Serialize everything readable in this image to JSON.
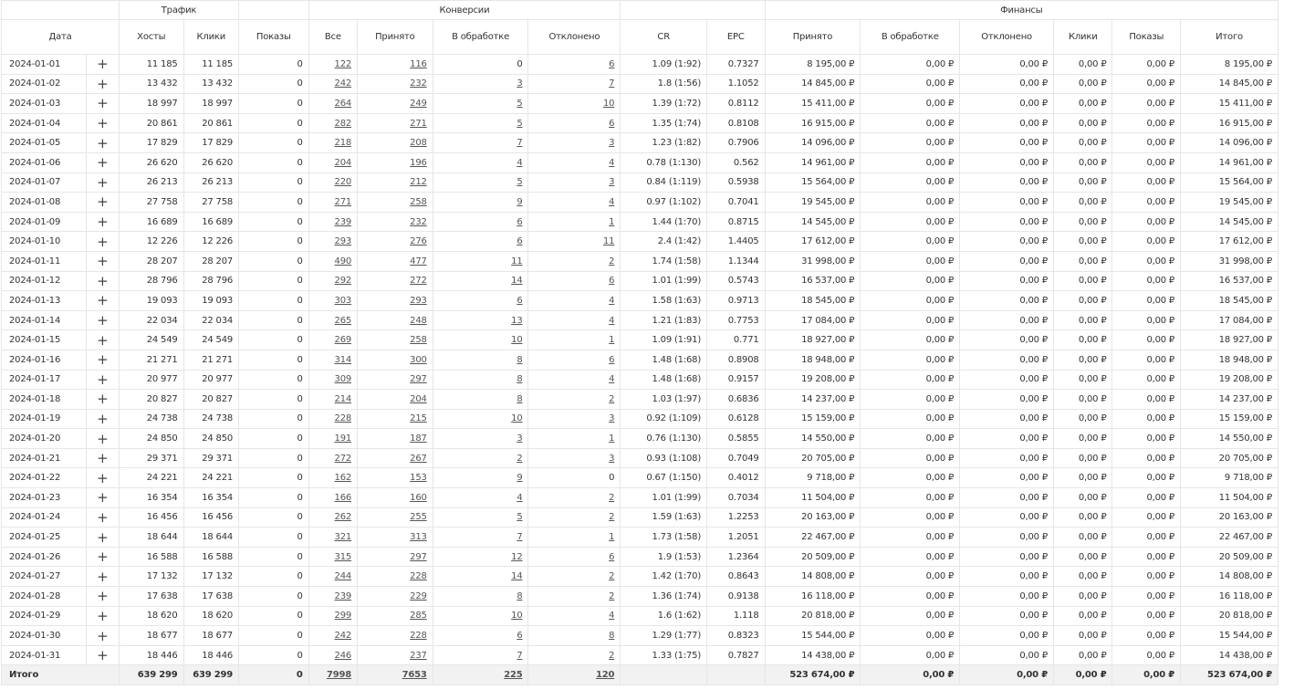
{
  "groups": {
    "traffic": "Трафик",
    "conversions": "Конверсии",
    "finance": "Финансы"
  },
  "columns": [
    "Дата",
    "",
    "Хосты",
    "Клики",
    "Показы",
    "Все",
    "Принято",
    "В обработке",
    "Отклонено",
    "CR",
    "EPC",
    "Принято",
    "В обработке",
    "Отклонено",
    "Клики",
    "Показы",
    "Итого"
  ],
  "expand_icon": "plus-icon",
  "rows": [
    [
      "2024-01-01",
      "11 185",
      "11 185",
      "0",
      "122",
      "116",
      "0",
      "6",
      "1.09 (1:92)",
      "0.7327",
      "8 195,00 ₽",
      "0,00 ₽",
      "0,00 ₽",
      "0,00 ₽",
      "0,00 ₽",
      "8 195,00 ₽"
    ],
    [
      "2024-01-02",
      "13 432",
      "13 432",
      "0",
      "242",
      "232",
      "3",
      "7",
      "1.8 (1:56)",
      "1.1052",
      "14 845,00 ₽",
      "0,00 ₽",
      "0,00 ₽",
      "0,00 ₽",
      "0,00 ₽",
      "14 845,00 ₽"
    ],
    [
      "2024-01-03",
      "18 997",
      "18 997",
      "0",
      "264",
      "249",
      "5",
      "10",
      "1.39 (1:72)",
      "0.8112",
      "15 411,00 ₽",
      "0,00 ₽",
      "0,00 ₽",
      "0,00 ₽",
      "0,00 ₽",
      "15 411,00 ₽"
    ],
    [
      "2024-01-04",
      "20 861",
      "20 861",
      "0",
      "282",
      "271",
      "5",
      "6",
      "1.35 (1:74)",
      "0.8108",
      "16 915,00 ₽",
      "0,00 ₽",
      "0,00 ₽",
      "0,00 ₽",
      "0,00 ₽",
      "16 915,00 ₽"
    ],
    [
      "2024-01-05",
      "17 829",
      "17 829",
      "0",
      "218",
      "208",
      "7",
      "3",
      "1.23 (1:82)",
      "0.7906",
      "14 096,00 ₽",
      "0,00 ₽",
      "0,00 ₽",
      "0,00 ₽",
      "0,00 ₽",
      "14 096,00 ₽"
    ],
    [
      "2024-01-06",
      "26 620",
      "26 620",
      "0",
      "204",
      "196",
      "4",
      "4",
      "0.78 (1:130)",
      "0.562",
      "14 961,00 ₽",
      "0,00 ₽",
      "0,00 ₽",
      "0,00 ₽",
      "0,00 ₽",
      "14 961,00 ₽"
    ],
    [
      "2024-01-07",
      "26 213",
      "26 213",
      "0",
      "220",
      "212",
      "5",
      "3",
      "0.84 (1:119)",
      "0.5938",
      "15 564,00 ₽",
      "0,00 ₽",
      "0,00 ₽",
      "0,00 ₽",
      "0,00 ₽",
      "15 564,00 ₽"
    ],
    [
      "2024-01-08",
      "27 758",
      "27 758",
      "0",
      "271",
      "258",
      "9",
      "4",
      "0.97 (1:102)",
      "0.7041",
      "19 545,00 ₽",
      "0,00 ₽",
      "0,00 ₽",
      "0,00 ₽",
      "0,00 ₽",
      "19 545,00 ₽"
    ],
    [
      "2024-01-09",
      "16 689",
      "16 689",
      "0",
      "239",
      "232",
      "6",
      "1",
      "1.44 (1:70)",
      "0.8715",
      "14 545,00 ₽",
      "0,00 ₽",
      "0,00 ₽",
      "0,00 ₽",
      "0,00 ₽",
      "14 545,00 ₽"
    ],
    [
      "2024-01-10",
      "12 226",
      "12 226",
      "0",
      "293",
      "276",
      "6",
      "11",
      "2.4 (1:42)",
      "1.4405",
      "17 612,00 ₽",
      "0,00 ₽",
      "0,00 ₽",
      "0,00 ₽",
      "0,00 ₽",
      "17 612,00 ₽"
    ],
    [
      "2024-01-11",
      "28 207",
      "28 207",
      "0",
      "490",
      "477",
      "11",
      "2",
      "1.74 (1:58)",
      "1.1344",
      "31 998,00 ₽",
      "0,00 ₽",
      "0,00 ₽",
      "0,00 ₽",
      "0,00 ₽",
      "31 998,00 ₽"
    ],
    [
      "2024-01-12",
      "28 796",
      "28 796",
      "0",
      "292",
      "272",
      "14",
      "6",
      "1.01 (1:99)",
      "0.5743",
      "16 537,00 ₽",
      "0,00 ₽",
      "0,00 ₽",
      "0,00 ₽",
      "0,00 ₽",
      "16 537,00 ₽"
    ],
    [
      "2024-01-13",
      "19 093",
      "19 093",
      "0",
      "303",
      "293",
      "6",
      "4",
      "1.58 (1:63)",
      "0.9713",
      "18 545,00 ₽",
      "0,00 ₽",
      "0,00 ₽",
      "0,00 ₽",
      "0,00 ₽",
      "18 545,00 ₽"
    ],
    [
      "2024-01-14",
      "22 034",
      "22 034",
      "0",
      "265",
      "248",
      "13",
      "4",
      "1.21 (1:83)",
      "0.7753",
      "17 084,00 ₽",
      "0,00 ₽",
      "0,00 ₽",
      "0,00 ₽",
      "0,00 ₽",
      "17 084,00 ₽"
    ],
    [
      "2024-01-15",
      "24 549",
      "24 549",
      "0",
      "269",
      "258",
      "10",
      "1",
      "1.09 (1:91)",
      "0.771",
      "18 927,00 ₽",
      "0,00 ₽",
      "0,00 ₽",
      "0,00 ₽",
      "0,00 ₽",
      "18 927,00 ₽"
    ],
    [
      "2024-01-16",
      "21 271",
      "21 271",
      "0",
      "314",
      "300",
      "8",
      "6",
      "1.48 (1:68)",
      "0.8908",
      "18 948,00 ₽",
      "0,00 ₽",
      "0,00 ₽",
      "0,00 ₽",
      "0,00 ₽",
      "18 948,00 ₽"
    ],
    [
      "2024-01-17",
      "20 977",
      "20 977",
      "0",
      "309",
      "297",
      "8",
      "4",
      "1.48 (1:68)",
      "0.9157",
      "19 208,00 ₽",
      "0,00 ₽",
      "0,00 ₽",
      "0,00 ₽",
      "0,00 ₽",
      "19 208,00 ₽"
    ],
    [
      "2024-01-18",
      "20 827",
      "20 827",
      "0",
      "214",
      "204",
      "8",
      "2",
      "1.03 (1:97)",
      "0.6836",
      "14 237,00 ₽",
      "0,00 ₽",
      "0,00 ₽",
      "0,00 ₽",
      "0,00 ₽",
      "14 237,00 ₽"
    ],
    [
      "2024-01-19",
      "24 738",
      "24 738",
      "0",
      "228",
      "215",
      "10",
      "3",
      "0.92 (1:109)",
      "0.6128",
      "15 159,00 ₽",
      "0,00 ₽",
      "0,00 ₽",
      "0,00 ₽",
      "0,00 ₽",
      "15 159,00 ₽"
    ],
    [
      "2024-01-20",
      "24 850",
      "24 850",
      "0",
      "191",
      "187",
      "3",
      "1",
      "0.76 (1:130)",
      "0.5855",
      "14 550,00 ₽",
      "0,00 ₽",
      "0,00 ₽",
      "0,00 ₽",
      "0,00 ₽",
      "14 550,00 ₽"
    ],
    [
      "2024-01-21",
      "29 371",
      "29 371",
      "0",
      "272",
      "267",
      "2",
      "3",
      "0.93 (1:108)",
      "0.7049",
      "20 705,00 ₽",
      "0,00 ₽",
      "0,00 ₽",
      "0,00 ₽",
      "0,00 ₽",
      "20 705,00 ₽"
    ],
    [
      "2024-01-22",
      "24 221",
      "24 221",
      "0",
      "162",
      "153",
      "9",
      "0",
      "0.67 (1:150)",
      "0.4012",
      "9 718,00 ₽",
      "0,00 ₽",
      "0,00 ₽",
      "0,00 ₽",
      "0,00 ₽",
      "9 718,00 ₽"
    ],
    [
      "2024-01-23",
      "16 354",
      "16 354",
      "0",
      "166",
      "160",
      "4",
      "2",
      "1.01 (1:99)",
      "0.7034",
      "11 504,00 ₽",
      "0,00 ₽",
      "0,00 ₽",
      "0,00 ₽",
      "0,00 ₽",
      "11 504,00 ₽"
    ],
    [
      "2024-01-24",
      "16 456",
      "16 456",
      "0",
      "262",
      "255",
      "5",
      "2",
      "1.59 (1:63)",
      "1.2253",
      "20 163,00 ₽",
      "0,00 ₽",
      "0,00 ₽",
      "0,00 ₽",
      "0,00 ₽",
      "20 163,00 ₽"
    ],
    [
      "2024-01-25",
      "18 644",
      "18 644",
      "0",
      "321",
      "313",
      "7",
      "1",
      "1.73 (1:58)",
      "1.2051",
      "22 467,00 ₽",
      "0,00 ₽",
      "0,00 ₽",
      "0,00 ₽",
      "0,00 ₽",
      "22 467,00 ₽"
    ],
    [
      "2024-01-26",
      "16 588",
      "16 588",
      "0",
      "315",
      "297",
      "12",
      "6",
      "1.9 (1:53)",
      "1.2364",
      "20 509,00 ₽",
      "0,00 ₽",
      "0,00 ₽",
      "0,00 ₽",
      "0,00 ₽",
      "20 509,00 ₽"
    ],
    [
      "2024-01-27",
      "17 132",
      "17 132",
      "0",
      "244",
      "228",
      "14",
      "2",
      "1.42 (1:70)",
      "0.8643",
      "14 808,00 ₽",
      "0,00 ₽",
      "0,00 ₽",
      "0,00 ₽",
      "0,00 ₽",
      "14 808,00 ₽"
    ],
    [
      "2024-01-28",
      "17 638",
      "17 638",
      "0",
      "239",
      "229",
      "8",
      "2",
      "1.36 (1:74)",
      "0.9138",
      "16 118,00 ₽",
      "0,00 ₽",
      "0,00 ₽",
      "0,00 ₽",
      "0,00 ₽",
      "16 118,00 ₽"
    ],
    [
      "2024-01-29",
      "18 620",
      "18 620",
      "0",
      "299",
      "285",
      "10",
      "4",
      "1.6 (1:62)",
      "1.118",
      "20 818,00 ₽",
      "0,00 ₽",
      "0,00 ₽",
      "0,00 ₽",
      "0,00 ₽",
      "20 818,00 ₽"
    ],
    [
      "2024-01-30",
      "18 677",
      "18 677",
      "0",
      "242",
      "228",
      "6",
      "8",
      "1.29 (1:77)",
      "0.8323",
      "15 544,00 ₽",
      "0,00 ₽",
      "0,00 ₽",
      "0,00 ₽",
      "0,00 ₽",
      "15 544,00 ₽"
    ],
    [
      "2024-01-31",
      "18 446",
      "18 446",
      "0",
      "246",
      "237",
      "7",
      "2",
      "1.33 (1:75)",
      "0.7827",
      "14 438,00 ₽",
      "0,00 ₽",
      "0,00 ₽",
      "0,00 ₽",
      "0,00 ₽",
      "14 438,00 ₽"
    ]
  ],
  "totals": [
    "Итого",
    "639 299",
    "639 299",
    "0",
    "7998",
    "7653",
    "225",
    "120",
    "",
    "",
    "523 674,00 ₽",
    "0,00 ₽",
    "0,00 ₽",
    "0,00 ₽",
    "0,00 ₽",
    "523 674,00 ₽"
  ]
}
